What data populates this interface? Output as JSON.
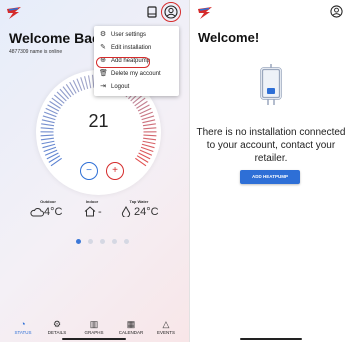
{
  "colors": {
    "brand_red": "#d52b2b",
    "accent_blue": "#2e6fd6",
    "text_dark": "#111111"
  },
  "left_screen": {
    "header": {
      "logo_icon": "heatpump-logo-icon",
      "icons": [
        "tablet-icon",
        "profile-icon"
      ]
    },
    "welcome_title": "Welcome Bac",
    "subline": "4877309 name is online",
    "dial": {
      "temperature": "21",
      "minus_button": "−",
      "plus_button": "+"
    },
    "readings": [
      {
        "label": "Outdoor",
        "value": "4°C",
        "icon": "cloud-icon"
      },
      {
        "label": "Indoor",
        "value": "-",
        "icon": "house-icon"
      },
      {
        "label": "Tap Water",
        "value": "24°C",
        "icon": "droplet-icon"
      }
    ],
    "page_dots": {
      "count": 5,
      "active_index": 0
    },
    "menu": {
      "items": [
        {
          "label": "User settings",
          "icon": "gear-icon"
        },
        {
          "label": "Edit installation",
          "icon": "edit-icon"
        },
        {
          "label": "Add heatpump",
          "icon": "add-circle-icon",
          "highlighted": true
        },
        {
          "label": "Delete my account",
          "icon": "trash-icon"
        },
        {
          "label": "Logout",
          "icon": "logout-icon"
        }
      ]
    },
    "bottom_nav": [
      {
        "label": "STATUS",
        "icon": "status-icon",
        "active": true
      },
      {
        "label": "DETAILS",
        "icon": "gear-icon",
        "active": false
      },
      {
        "label": "GRAPHS",
        "icon": "bar-chart-icon",
        "active": false
      },
      {
        "label": "CALENDAR",
        "icon": "calendar-icon",
        "active": false
      },
      {
        "label": "EVENTS",
        "icon": "bell-icon",
        "active": false
      }
    ]
  },
  "right_screen": {
    "header": {
      "logo_icon": "heatpump-logo-icon",
      "icons": [
        "profile-icon"
      ]
    },
    "title": "Welcome!",
    "illustration_icon": "water-heater-icon",
    "message": "There is no installation connected to your account, contact your retailer.",
    "button_label": "ADD HEATPUMP"
  }
}
